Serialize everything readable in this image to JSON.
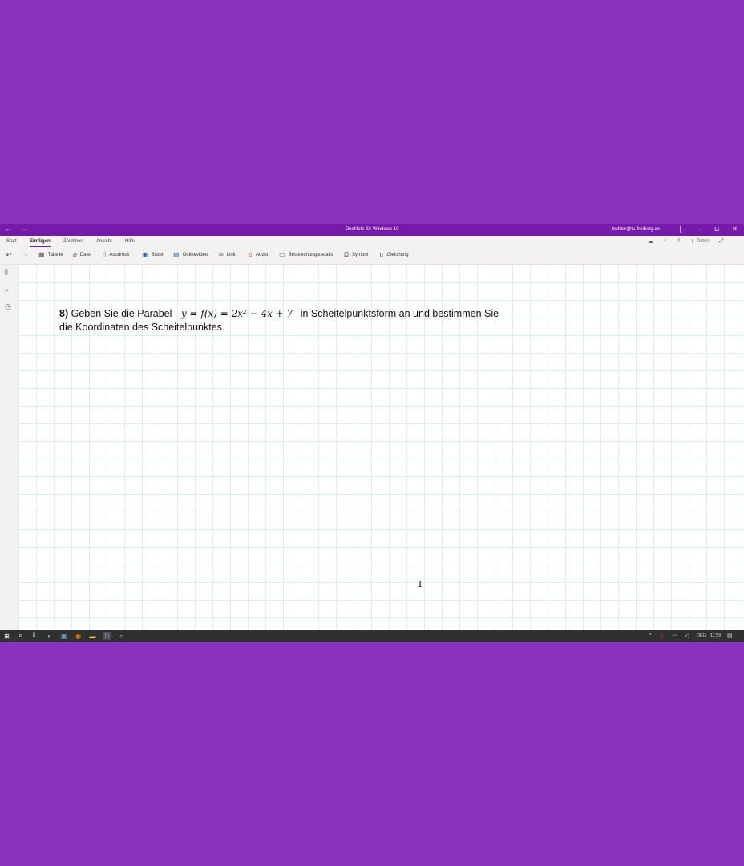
{
  "window": {
    "title": "OneNote für Windows 10",
    "account": "tochter@tu-freiberg.de",
    "back_icon": "←",
    "forward_icon": "→",
    "minimize_icon": "–",
    "restore_icon": "⊔",
    "close_icon": "✕"
  },
  "menu": {
    "tabs": [
      {
        "label": "Start"
      },
      {
        "label": "Einfügen"
      },
      {
        "label": "Zeichnen"
      },
      {
        "label": "Ansicht"
      },
      {
        "label": "Hilfe"
      }
    ],
    "active_tab": "Einfügen",
    "share_label": "Teilen"
  },
  "ribbon": {
    "items": [
      {
        "label": "Tabelle",
        "icon": "table-icon"
      },
      {
        "label": "Datei",
        "icon": "paperclip-icon"
      },
      {
        "label": "Ausdruck",
        "icon": "page-icon"
      },
      {
        "label": "Bilder",
        "icon": "image-icon"
      },
      {
        "label": "Onlinevideo",
        "icon": "video-icon"
      },
      {
        "label": "Link",
        "icon": "link-icon"
      },
      {
        "label": "Audio",
        "icon": "microphone-icon"
      },
      {
        "label": "Besprechungsdetails",
        "icon": "calendar-icon"
      },
      {
        "label": "Symbol",
        "icon": "omega-icon"
      },
      {
        "label": "Gleichung",
        "icon": "pi-icon"
      }
    ]
  },
  "note": {
    "number": "8)",
    "text_before": "Geben Sie die Parabel",
    "equation": "y = f(x) = 2x² − 4x + 7",
    "text_after": "in Scheitelpunktsform an und bestimmen Sie die Koordinaten des Scheitelpunktes."
  },
  "taskbar": {
    "language": "DEU",
    "time": "11:59"
  },
  "colors": {
    "desktop_background": "#8a32c0",
    "onenote_purple": "#7719aa",
    "grid_line": "#dceef3",
    "taskbar": "#2f3130"
  }
}
